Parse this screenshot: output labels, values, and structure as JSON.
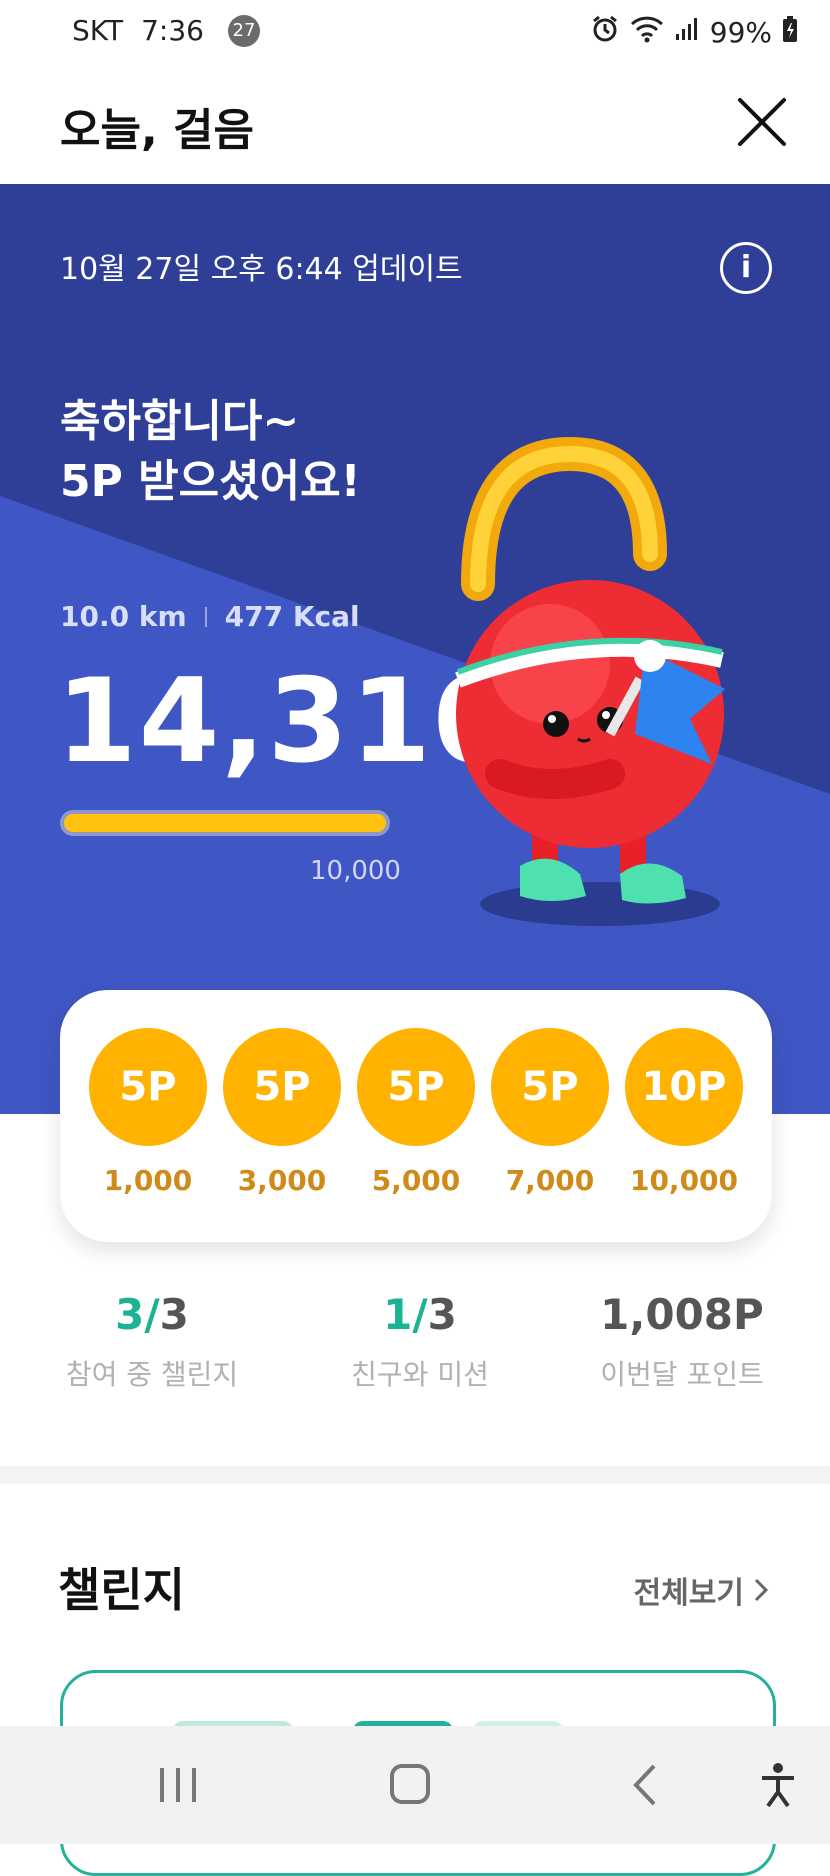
{
  "status_bar": {
    "carrier": "SKT",
    "time": "7:36",
    "notification_count": "27",
    "battery": "99%"
  },
  "header": {
    "title": "오늘, 걸음"
  },
  "hero": {
    "updated": "10월 27일 오후 6:44 업데이트",
    "congrats_line1": "축하합니다~",
    "congrats_line2": "5P 받으셨어요!",
    "distance": "10.0 km",
    "calories": "477 Kcal",
    "steps": "14,310",
    "goal": "10,000",
    "progress_fraction": 1.0
  },
  "rewards": [
    {
      "points": "5P",
      "steps": "1,000"
    },
    {
      "points": "5P",
      "steps": "3,000"
    },
    {
      "points": "5P",
      "steps": "5,000"
    },
    {
      "points": "5P",
      "steps": "7,000"
    },
    {
      "points": "10P",
      "steps": "10,000"
    }
  ],
  "summary": {
    "challenges": {
      "current": "3/",
      "total": "3",
      "label": "참여 중 챌린지"
    },
    "missions": {
      "current": "1/",
      "total": "3",
      "label": "친구와 미션"
    },
    "points": {
      "value": "1,008P",
      "label": "이번달 포인트"
    }
  },
  "challenge_section": {
    "title": "챌린지",
    "view_all": "전체보기"
  },
  "colors": {
    "hero_dark": "#2f3f98",
    "hero_light": "#3f57c4",
    "coin": "#ffb300",
    "accent_green": "#1ab394",
    "progress": "#ffc20e"
  }
}
